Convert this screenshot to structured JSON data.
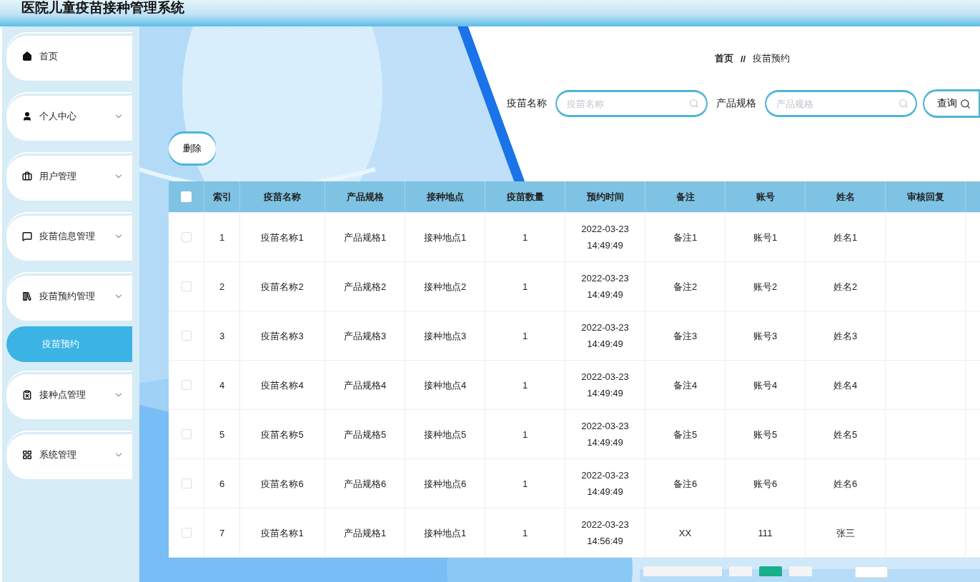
{
  "header": {
    "title": "医院儿童疫苗接种管理系统"
  },
  "sidebar": {
    "items": [
      {
        "label": "首页",
        "submenu": false
      },
      {
        "label": "个人中心",
        "submenu": true
      },
      {
        "label": "用户管理",
        "submenu": true
      },
      {
        "label": "疫苗信息管理",
        "submenu": true
      },
      {
        "label": "疫苗预约管理",
        "submenu": true,
        "children": [
          {
            "label": "疫苗预约",
            "selected": true
          }
        ]
      },
      {
        "label": "接种点管理",
        "submenu": true
      },
      {
        "label": "系统管理",
        "submenu": true
      }
    ]
  },
  "breadcrumb": {
    "items": [
      "首页",
      "疫苗预约"
    ],
    "separator": "//"
  },
  "search": {
    "fields": [
      {
        "label": "疫苗名称",
        "placeholder": "疫苗名称"
      },
      {
        "label": "产品规格",
        "placeholder": "产品规格"
      }
    ],
    "button": "查询"
  },
  "actions": {
    "delete": "删除"
  },
  "table": {
    "all_checked": false,
    "columns": [
      "索引",
      "疫苗名称",
      "产品规格",
      "接种地点",
      "疫苗数量",
      "预约时间",
      "备注",
      "账号",
      "姓名",
      "审核回复"
    ],
    "rows": [
      {
        "checked": false,
        "cells": [
          "1",
          "疫苗名称1",
          "产品规格1",
          "接种地点1",
          "1",
          "2022-03-23 14:49:49",
          "备注1",
          "账号1",
          "姓名1"
        ]
      },
      {
        "checked": false,
        "cells": [
          "2",
          "疫苗名称2",
          "产品规格2",
          "接种地点2",
          "1",
          "2022-03-23 14:49:49",
          "备注2",
          "账号2",
          "姓名2"
        ]
      },
      {
        "checked": false,
        "cells": [
          "3",
          "疫苗名称3",
          "产品规格3",
          "接种地点3",
          "1",
          "2022-03-23 14:49:49",
          "备注3",
          "账号3",
          "姓名3"
        ]
      },
      {
        "checked": false,
        "cells": [
          "4",
          "疫苗名称4",
          "产品规格4",
          "接种地点4",
          "1",
          "2022-03-23 14:49:49",
          "备注4",
          "账号4",
          "姓名4"
        ]
      },
      {
        "checked": false,
        "cells": [
          "5",
          "疫苗名称5",
          "产品规格5",
          "接种地点5",
          "1",
          "2022-03-23 14:49:49",
          "备注5",
          "账号5",
          "姓名5"
        ]
      },
      {
        "checked": false,
        "cells": [
          "6",
          "疫苗名称6",
          "产品规格6",
          "接种地点6",
          "1",
          "2022-03-23 14:49:49",
          "备注6",
          "账号6",
          "姓名6"
        ]
      },
      {
        "checked": false,
        "cells": [
          "7",
          "疫苗名称1",
          "产品规格1",
          "接种地点1",
          "1",
          "2022-03-23 14:56:49",
          "XX",
          "111",
          "张三"
        ]
      }
    ]
  },
  "pagination": {
    "pages": [
      {
        "selected": false
      },
      {
        "selected": true
      },
      {
        "selected": false
      }
    ]
  }
}
